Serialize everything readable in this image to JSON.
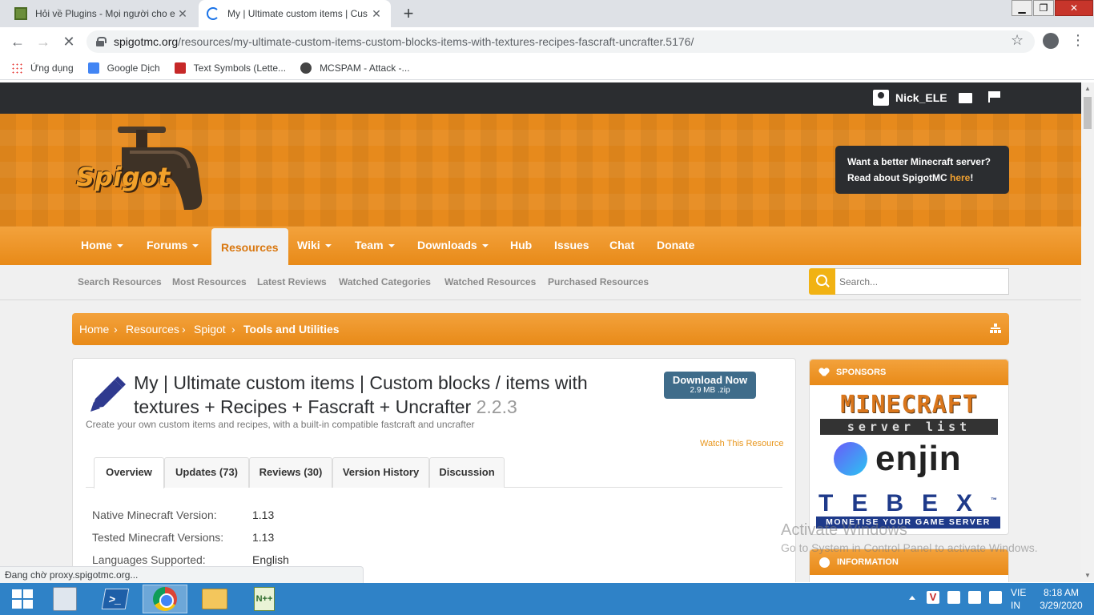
{
  "browser": {
    "tabs": [
      {
        "title": "Hỏi về Plugins - Mọi người cho e",
        "active": false
      },
      {
        "title": "My | Ultimate custom items | Cus",
        "active": true
      }
    ],
    "url_host": "spigotmc.org",
    "url_path": "/resources/my-ultimate-custom-items-custom-blocks-items-with-textures-recipes-fascraft-uncrafter.5176/",
    "bookmarks": [
      "Ứng dụng",
      "Google Dịch",
      "Text Symbols (Lette...",
      "MCSPAM - Attack -..."
    ],
    "status": "Đang chờ proxy.spigotmc.org..."
  },
  "site": {
    "username": "Nick_ELE",
    "logo_text": "Spigot",
    "promo_line1": "Want a better Minecraft server?",
    "promo_line2": "Read about SpigotMC ",
    "promo_link": "here",
    "promo_end": "!",
    "nav": [
      {
        "label": "Home",
        "dropdown": true
      },
      {
        "label": "Forums",
        "dropdown": true
      },
      {
        "label": "Resources",
        "dropdown": false,
        "selected": true
      },
      {
        "label": "Wiki",
        "dropdown": true
      },
      {
        "label": "Team",
        "dropdown": true
      },
      {
        "label": "Downloads",
        "dropdown": true
      },
      {
        "label": "Hub",
        "dropdown": false
      },
      {
        "label": "Issues",
        "dropdown": false
      },
      {
        "label": "Chat",
        "dropdown": false
      },
      {
        "label": "Donate",
        "dropdown": false
      }
    ],
    "subnav": [
      "Search Resources",
      "Most Resources",
      "Latest Reviews",
      "Watched Categories",
      "Watched Resources",
      "Purchased Resources"
    ],
    "search_placeholder": "Search...",
    "breadcrumb": [
      "Home",
      "Resources",
      "Spigot",
      "Tools and Utilities"
    ],
    "accent_color": "#e88a18"
  },
  "resource": {
    "title": "My | Ultimate custom items | Custom blocks / items with textures + Recipes + Fascraft + Uncrafter",
    "version": "2.2.3",
    "tagline": "Create your own custom items and recipes, with a built-in compatible fastcraft and uncrafter",
    "download_label": "Download Now",
    "download_size": "2.9 MB .zip",
    "watch_label": "Watch This Resource",
    "tabs": [
      "Overview",
      "Updates (73)",
      "Reviews (30)",
      "Version History",
      "Discussion"
    ],
    "info": [
      {
        "label": "Native Minecraft Version:",
        "value": "1.13"
      },
      {
        "label": "Tested Minecraft Versions:",
        "value": "1.13"
      },
      {
        "label": "Languages Supported:",
        "value": "English"
      }
    ]
  },
  "sidebar": {
    "sponsors_title": "SPONSORS",
    "mcsl_top": "MINECRAFT",
    "mcsl_bottom": "server list",
    "enjin": "enjin",
    "tebex_top": "TEBEX",
    "tebex_tm": "™",
    "tebex_bottom": "MONETISE YOUR GAME SERVER",
    "info_title": "INFORMATION"
  },
  "watermark": {
    "line1": "Activate Windows",
    "line2": "Go to System in Control Panel to activate Windows."
  },
  "taskbar": {
    "lang1": "VIE",
    "lang2": "IN",
    "time": "8:18 AM",
    "date": "3/29/2020"
  }
}
